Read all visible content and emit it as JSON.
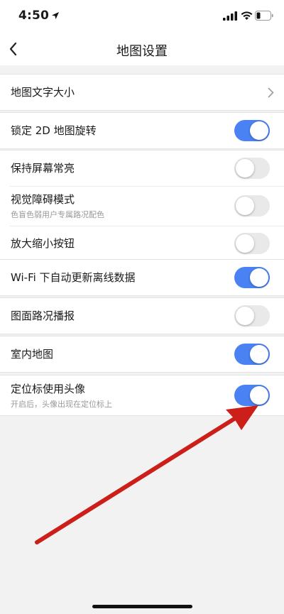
{
  "status": {
    "time": "4:50"
  },
  "nav": {
    "title": "地图设置"
  },
  "settings": [
    {
      "label": "地图文字大小",
      "type": "chevron"
    },
    {
      "label": "锁定 2D 地图旋转",
      "type": "toggle",
      "on": true
    },
    {
      "label": "保持屏幕常亮",
      "type": "toggle",
      "on": false
    },
    {
      "label": "视觉障碍模式",
      "sub": "色盲色弱用户专属路况配色",
      "type": "toggle",
      "on": false
    },
    {
      "label": "放大缩小按钮",
      "type": "toggle",
      "on": false
    },
    {
      "label": "Wi-Fi 下自动更新离线数据",
      "type": "toggle",
      "on": true
    },
    {
      "label": "图面路况播报",
      "type": "toggle",
      "on": false
    },
    {
      "label": "室内地图",
      "type": "toggle",
      "on": true
    },
    {
      "label": "定位标使用头像",
      "sub": "开启后，头像出现在定位标上",
      "type": "toggle",
      "on": true
    }
  ],
  "colors": {
    "toggle_on": "#4a82f3",
    "toggle_off": "#e9e9ea",
    "annotation_arrow": "#cc1f1a"
  },
  "icons": {
    "back": "chevron-left-icon",
    "disclosure": "chevron-right-icon"
  }
}
